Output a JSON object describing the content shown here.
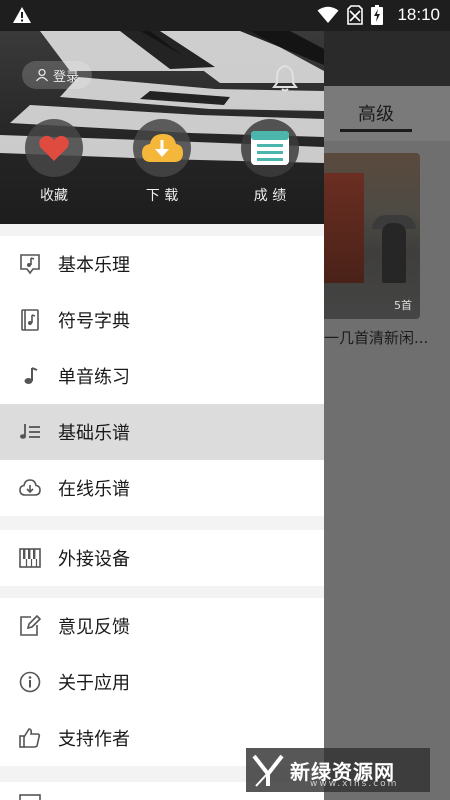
{
  "status_bar": {
    "time": "18:10"
  },
  "background_app": {
    "active_tab": "高级",
    "card_count": "5首",
    "card_caption": "一几首清新闲..."
  },
  "drawer": {
    "login_label": "登录",
    "quick_actions": [
      {
        "label": "收藏",
        "icon": "heart-icon"
      },
      {
        "label": "下 载",
        "icon": "cloud-download-icon"
      },
      {
        "label": "成 绩",
        "icon": "scores-icon"
      }
    ],
    "menu_group_1": [
      {
        "label": "基本乐理",
        "icon": "music-note-box-icon"
      },
      {
        "label": "符号字典",
        "icon": "music-book-icon"
      },
      {
        "label": "单音练习",
        "icon": "single-note-icon"
      },
      {
        "label": "基础乐谱",
        "icon": "music-list-icon",
        "active": true
      },
      {
        "label": "在线乐谱",
        "icon": "cloud-download-icon"
      }
    ],
    "menu_group_2": [
      {
        "label": "外接设备",
        "icon": "piano-keys-icon"
      }
    ],
    "menu_group_3": [
      {
        "label": "意见反馈",
        "icon": "edit-icon"
      },
      {
        "label": "关于应用",
        "icon": "info-icon"
      },
      {
        "label": "支持作者",
        "icon": "thumbs-up-icon"
      }
    ]
  },
  "watermark": {
    "text": "新绿资源网",
    "url": "www.xlhs.com"
  },
  "colors": {
    "drawer_bg": "#ffffff",
    "active_item": "#dcdcdc",
    "header_dark": "#262626",
    "heart_red": "#e04b3f",
    "download_orange": "#f5b73a",
    "scores_teal": "#4db6ac"
  }
}
